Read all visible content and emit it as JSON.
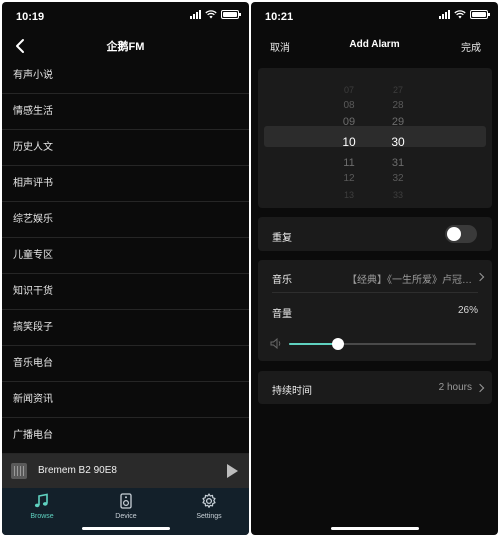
{
  "left": {
    "status": {
      "time": "10:19"
    },
    "header": {
      "title": "企鹅FM"
    },
    "categories": [
      "有声小说",
      "情感生活",
      "历史人文",
      "相声评书",
      "综艺娱乐",
      "儿童专区",
      "知识干货",
      "搞笑段子",
      "音乐电台",
      "新闻资讯",
      "广播电台"
    ],
    "player": {
      "device_name": "Bremem B2 90E8"
    },
    "tabs": [
      {
        "label": "Browse",
        "icon": "music-note-icon"
      },
      {
        "label": "Device",
        "icon": "speaker-icon"
      },
      {
        "label": "Settings",
        "icon": "gear-icon"
      }
    ]
  },
  "right": {
    "status": {
      "time": "10:21"
    },
    "header": {
      "cancel": "取消",
      "title": "Add Alarm",
      "done": "完成"
    },
    "picker": {
      "hours": [
        "07",
        "08",
        "09",
        "10",
        "11",
        "12",
        "13"
      ],
      "minutes": [
        "27",
        "28",
        "29",
        "30",
        "31",
        "32",
        "33"
      ],
      "selected_hour": "10",
      "selected_minute": "30"
    },
    "repeat": {
      "label": "重复",
      "enabled": false
    },
    "music": {
      "label": "音乐",
      "value": "【经典】《一生所爱》卢冠…"
    },
    "volume": {
      "label": "音量",
      "value": "26%",
      "level": 26
    },
    "duration": {
      "label": "持续时间",
      "value": "2 hours"
    }
  },
  "colors": {
    "accent": "#5fd2c0",
    "tabbar": "#13202a",
    "background": "#0b0b0b",
    "card": "#1b1b1b"
  }
}
